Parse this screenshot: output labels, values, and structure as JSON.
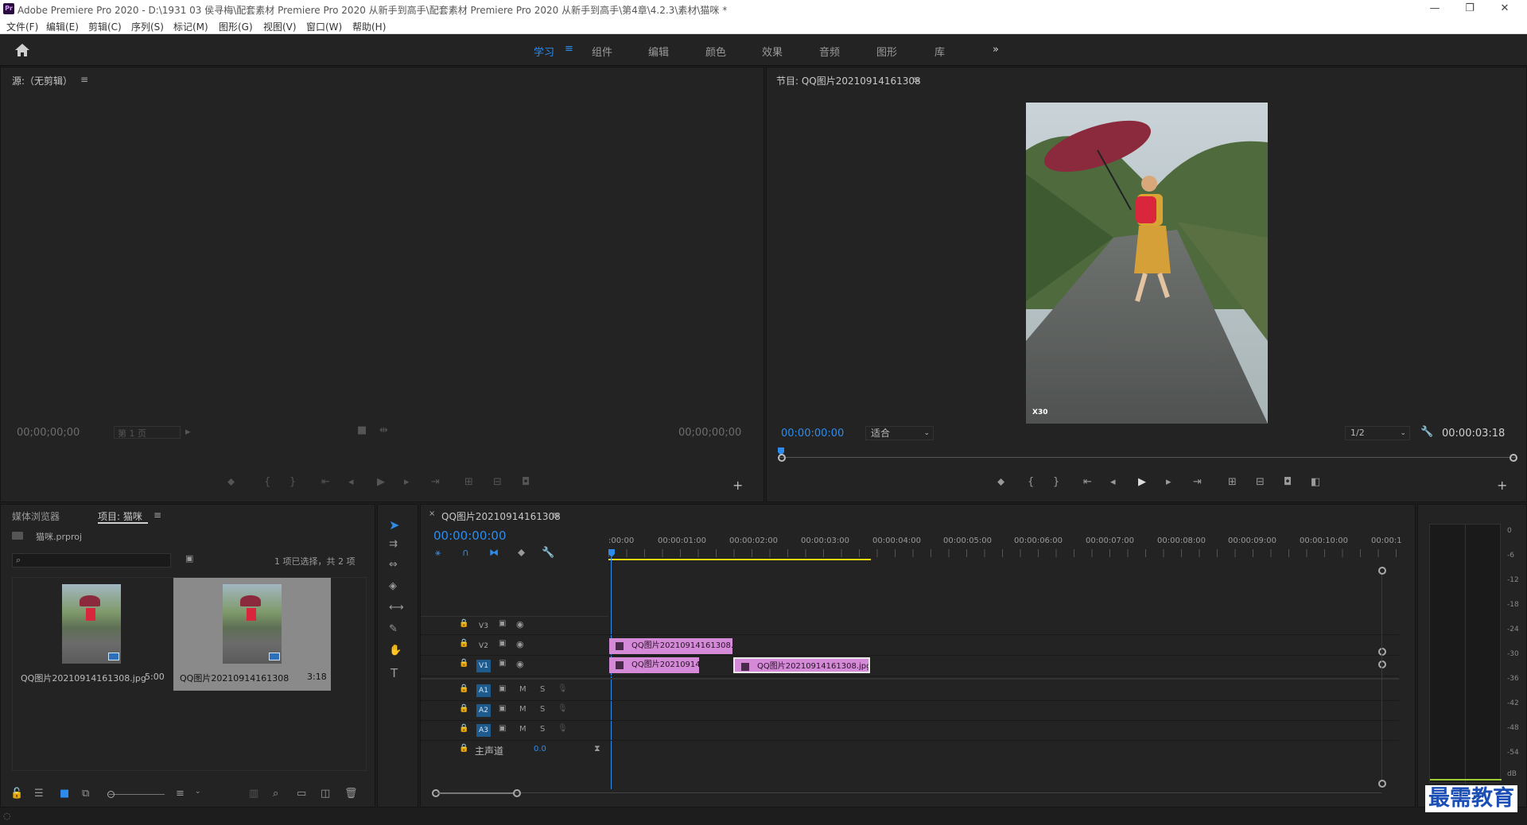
{
  "app": {
    "title": "Adobe Premiere Pro 2020 - D:\\1931 03 侯寻梅\\配套素材 Premiere Pro 2020 从新手到高手\\配套素材 Premiere Pro 2020 从新手到高手\\第4章\\4.2.3\\素材\\猫咪 *",
    "logo": "Pr",
    "window_controls": [
      "—",
      "❐",
      "✕"
    ]
  },
  "menu": [
    "文件(F)",
    "编辑(E)",
    "剪辑(C)",
    "序列(S)",
    "标记(M)",
    "图形(G)",
    "视图(V)",
    "窗口(W)",
    "帮助(H)"
  ],
  "workspaces": {
    "tabs": [
      "学习",
      "组件",
      "编辑",
      "颜色",
      "效果",
      "音频",
      "图形",
      "库"
    ],
    "active": "学习",
    "more": "»"
  },
  "source_monitor": {
    "title": "源:（无剪辑）",
    "timecode_left": "00;00;00;00",
    "page_select": "第 1 页",
    "timecode_right": "00;00;00;00"
  },
  "program_monitor": {
    "title": "节目: QQ图片20210914161308",
    "timecode": "00:00:00:00",
    "fit": "适合",
    "resolution": "1/2",
    "duration": "00:00:03:18",
    "watermark": "X30"
  },
  "project_panel": {
    "tabs": [
      "媒体浏览器",
      "项目: 猫咪"
    ],
    "active_tab": "项目: 猫咪",
    "file": "猫咪.prproj",
    "selection_info": "1 项已选择，共 2 项",
    "items": [
      {
        "name": "QQ图片20210914161308.jpg",
        "duration": "5:00",
        "selected": false
      },
      {
        "name": "QQ图片20210914161308",
        "duration": "3:18",
        "selected": true
      }
    ]
  },
  "timeline": {
    "tab": "QQ图片20210914161308",
    "timecode": "00:00:00:00",
    "ruler": [
      ":00:00",
      "00:00:01:00",
      "00:00:02:00",
      "00:00:03:00",
      "00:00:04:00",
      "00:00:05:00",
      "00:00:06:00",
      "00:00:07:00",
      "00:00:08:00",
      "00:00:09:00",
      "00:00:10:00",
      "00:00:1"
    ],
    "video_tracks": [
      {
        "label": "V3",
        "active": false
      },
      {
        "label": "V2",
        "active": false
      },
      {
        "label": "V1",
        "active": true
      }
    ],
    "audio_tracks": [
      {
        "label": "A1",
        "m": "M",
        "s": "S"
      },
      {
        "label": "A2",
        "m": "M",
        "s": "S"
      },
      {
        "label": "A3",
        "m": "M",
        "s": "S"
      }
    ],
    "master": {
      "label": "主声道",
      "value": "0.0"
    },
    "clips": {
      "v2": "QQ图片20210914161308.jpg",
      "v1a": "QQ图片202109141",
      "v1b": "QQ图片20210914161308.jpg"
    }
  },
  "audio_meter": {
    "scale": [
      "0",
      "-6",
      "-12",
      "-18",
      "-24",
      "-30",
      "-36",
      "-42",
      "-48",
      "-54",
      "dB"
    ]
  },
  "brand_watermark": "最需教育",
  "colors": {
    "accent": "#2d8ceb",
    "clip": "#d48ad6",
    "in_out_bar": "#e8d60d",
    "track_active": "#1e5a8c"
  }
}
